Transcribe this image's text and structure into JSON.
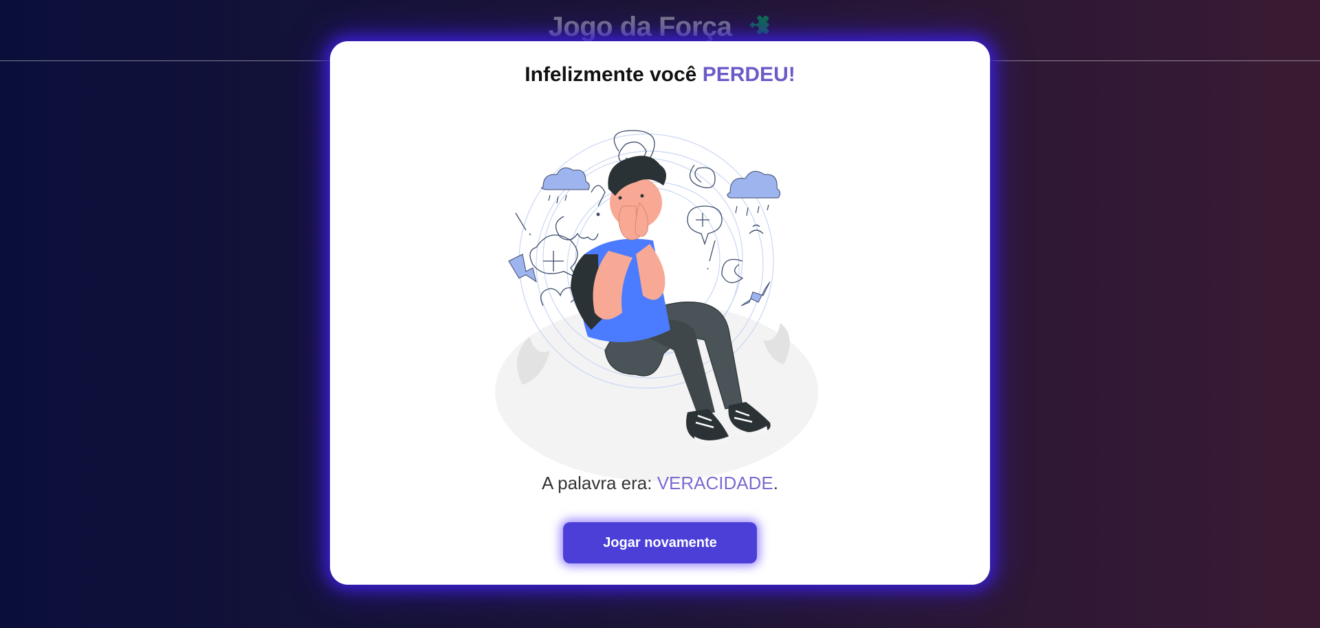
{
  "app": {
    "title": "Jogo da Força",
    "title_icon": "puzzle-icon"
  },
  "modal": {
    "title_prefix": "Infelizmente você ",
    "title_accent": "PERDEU!",
    "illustration": "sad-person-illustration",
    "word_prefix": "A palavra era: ",
    "word": "VERACIDADE",
    "word_suffix": ".",
    "play_again_label": "Jogar novamente"
  },
  "colors": {
    "accent": "#6b5bc8",
    "button": "#4b3fd8",
    "glow": "#3a1fd0",
    "title_icon": "#0f6b4a"
  }
}
